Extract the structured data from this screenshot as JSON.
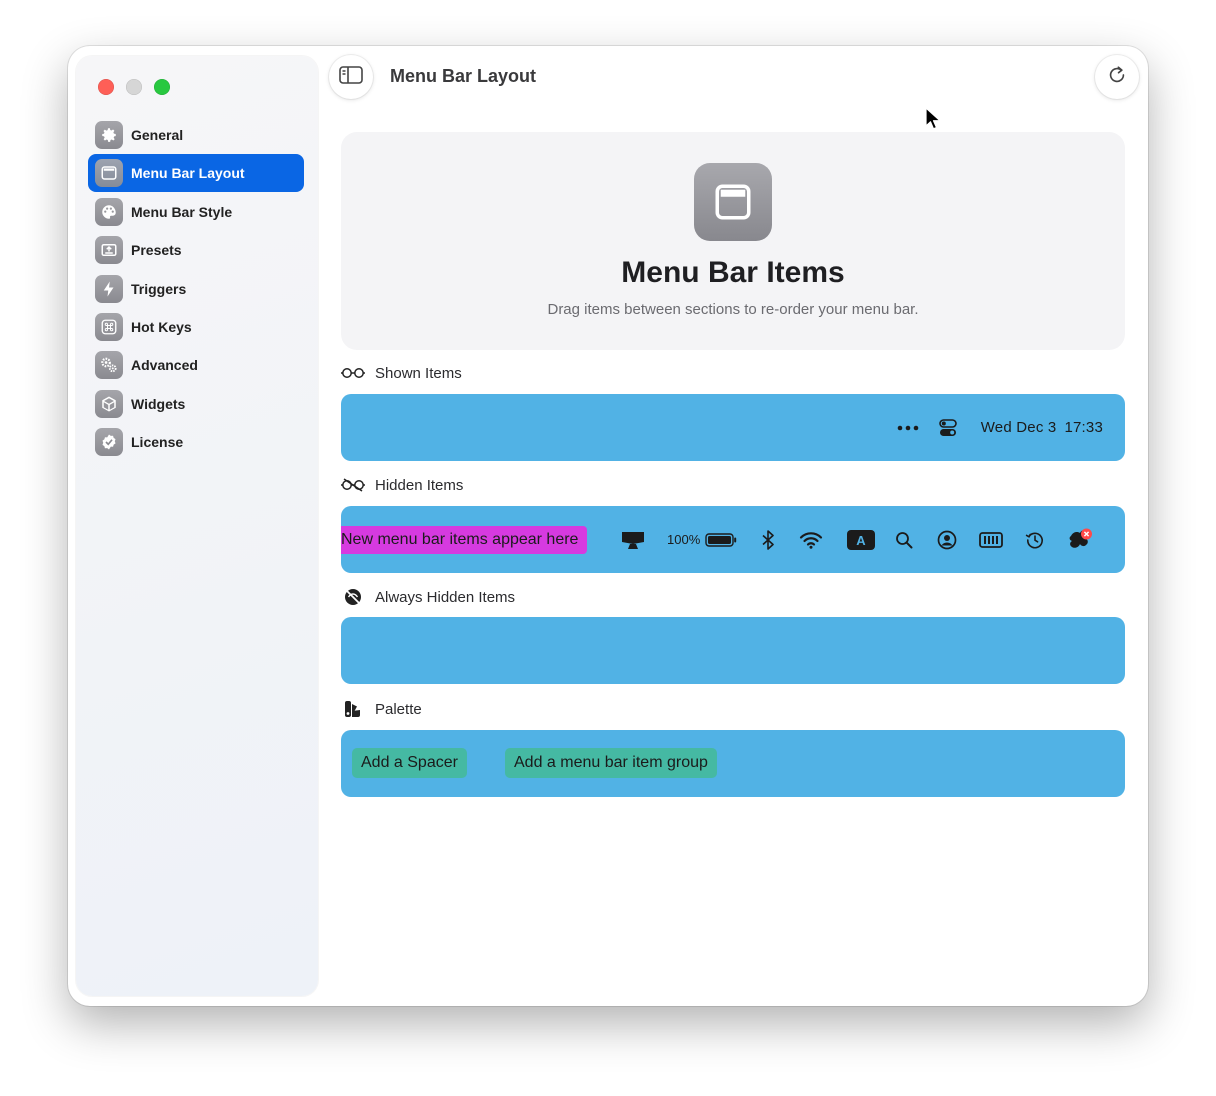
{
  "window": {
    "title": "Menu Bar Layout"
  },
  "sidebar": {
    "items": [
      {
        "label": "General",
        "icon": "gear-icon"
      },
      {
        "label": "Menu Bar Layout",
        "icon": "menubar-window-icon",
        "active": true
      },
      {
        "label": "Menu Bar Style",
        "icon": "palette-icon"
      },
      {
        "label": "Presets",
        "icon": "presets-icon"
      },
      {
        "label": "Triggers",
        "icon": "bolt-icon"
      },
      {
        "label": "Hot Keys",
        "icon": "command-key-icon"
      },
      {
        "label": "Advanced",
        "icon": "gears-icon"
      },
      {
        "label": "Widgets",
        "icon": "cube-icon"
      },
      {
        "label": "License",
        "icon": "checkmark-seal-icon"
      }
    ]
  },
  "hero": {
    "title": "Menu Bar Items",
    "subtitle": "Drag items between sections to re-order your menu bar."
  },
  "sections": {
    "shown": {
      "label": "Shown Items",
      "clock_date": "Wed Dec 3",
      "clock_time": "17:33"
    },
    "hidden": {
      "label": "Hidden Items",
      "new_items_text": "New menu bar items appear here",
      "battery_percent": "100%",
      "input_source_letter": "A"
    },
    "always_hidden": {
      "label": "Always Hidden Items"
    },
    "palette": {
      "label": "Palette",
      "add_spacer": "Add a Spacer",
      "add_group": "Add a menu bar item group"
    }
  },
  "colors": {
    "accent": "#0a66e4",
    "section_bg": "#51b2e5",
    "new_items_bg": "#d63ae0",
    "palette_chip_bg": "#45b9a3"
  }
}
